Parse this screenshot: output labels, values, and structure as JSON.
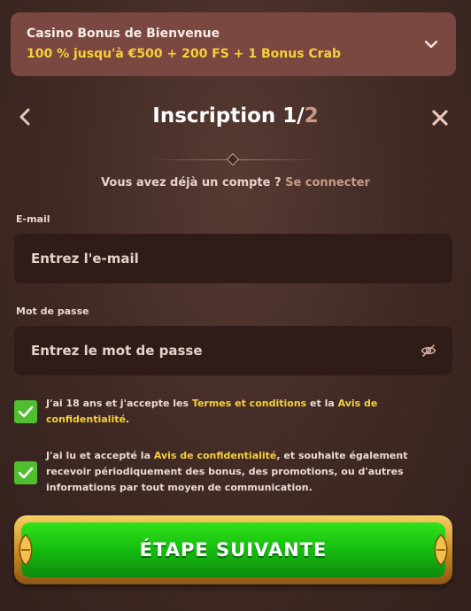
{
  "bonus": {
    "title": "Casino Bonus de Bienvenue",
    "offer": "100 % jusqu'à €500 + 200 FS + 1 Bonus Crab"
  },
  "header": {
    "title_prefix": "Inscription 1/",
    "title_total": "2"
  },
  "login": {
    "prompt": "Vous avez déjà un compte ?",
    "link": "Se connecter"
  },
  "email": {
    "label": "E-mail",
    "placeholder": "Entrez l'e-mail",
    "value": ""
  },
  "password": {
    "label": "Mot de passe",
    "placeholder": "Entrez le mot de passe",
    "value": ""
  },
  "consents": [
    {
      "checked": true,
      "text_1": "J'ai 18 ans et j'accepte les ",
      "link_1": "Termes et conditions",
      "text_2": " et la ",
      "link_2": "Avis de confidentialité",
      "text_3": "."
    },
    {
      "checked": true,
      "text_1": "J'ai lu et accepté la ",
      "link_1": "Avis de confidentialité",
      "text_2": ", et souhaite également recevoir périodiquement des bonus, des promotions, ou d'autres informations par tout moyen de communication."
    }
  ],
  "cta": {
    "label": "ÉTAPE SUIVANTE"
  },
  "icons": {
    "bonus_toggle": "chevron-down-icon",
    "back": "chevron-left-icon",
    "close": "close-icon",
    "password_visibility": "eye-slash-icon",
    "checkbox": "checkmark-icon"
  },
  "colors": {
    "background": "#3f2924",
    "bonus_panel": "#7a4840",
    "highlight": "#f7cf3a",
    "link": "#c99a87",
    "checkbox": "#4fbe2f",
    "cta_green": "#17c110",
    "cta_gold": "#f6cf62"
  }
}
